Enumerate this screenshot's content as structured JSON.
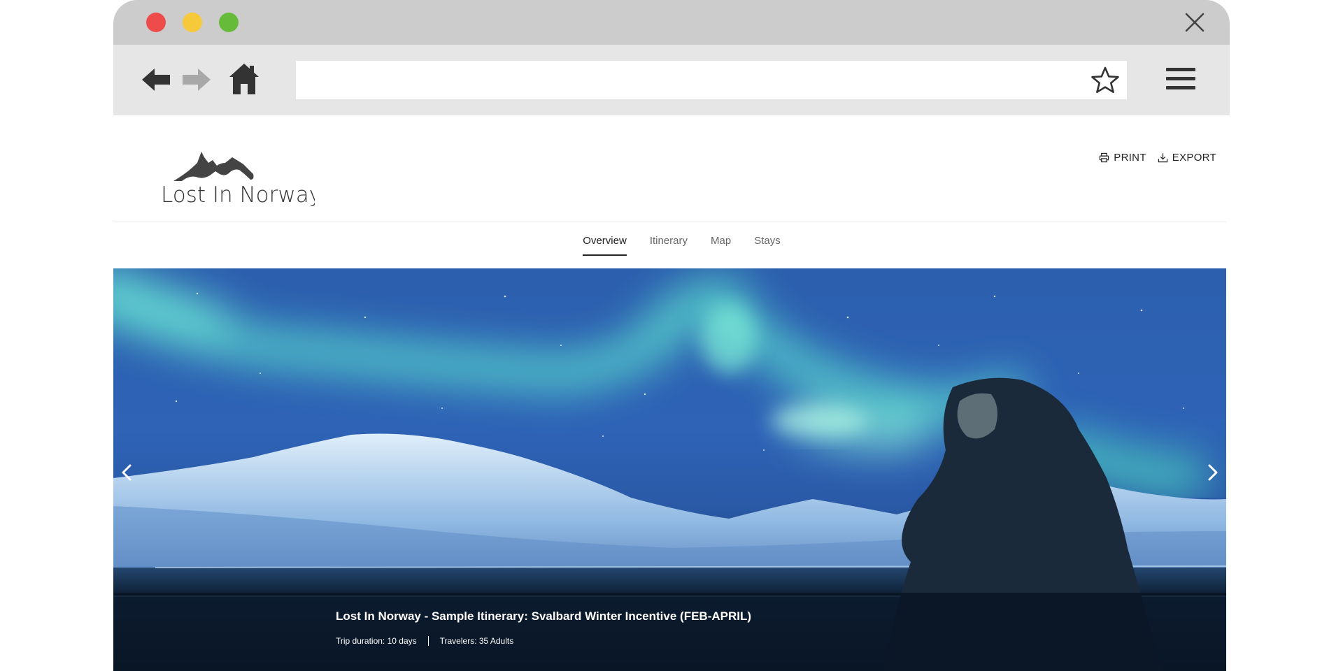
{
  "browser": {
    "icons": {
      "back": "arrow-left-icon",
      "forward": "arrow-right-icon",
      "home": "home-icon",
      "bookmark": "star-icon",
      "menu": "hamburger-menu-icon",
      "close": "close-icon"
    },
    "url": ""
  },
  "site": {
    "logo_text": "Lost In Norway",
    "actions": {
      "print_label": "PRINT",
      "export_label": "EXPORT"
    },
    "tabs": [
      {
        "label": "Overview",
        "active": true
      },
      {
        "label": "Itinerary",
        "active": false
      },
      {
        "label": "Map",
        "active": false
      },
      {
        "label": "Stays",
        "active": false
      }
    ]
  },
  "hero": {
    "title": "Lost In Norway - Sample Itinerary: Svalbard Winter Incentive (FEB-APRIL)",
    "trip_duration": "Trip duration: 10 days",
    "travelers": "Travelers: 35 Adults"
  },
  "colors": {
    "titlebar": "#cccccc",
    "toolbar": "#e6e6e6",
    "close_dot": "#ee4b4b",
    "minimize_dot": "#f6c93a",
    "maximize_dot": "#66bb3b",
    "aurora": "#5fe8d0",
    "sky": "#2c5fae"
  }
}
